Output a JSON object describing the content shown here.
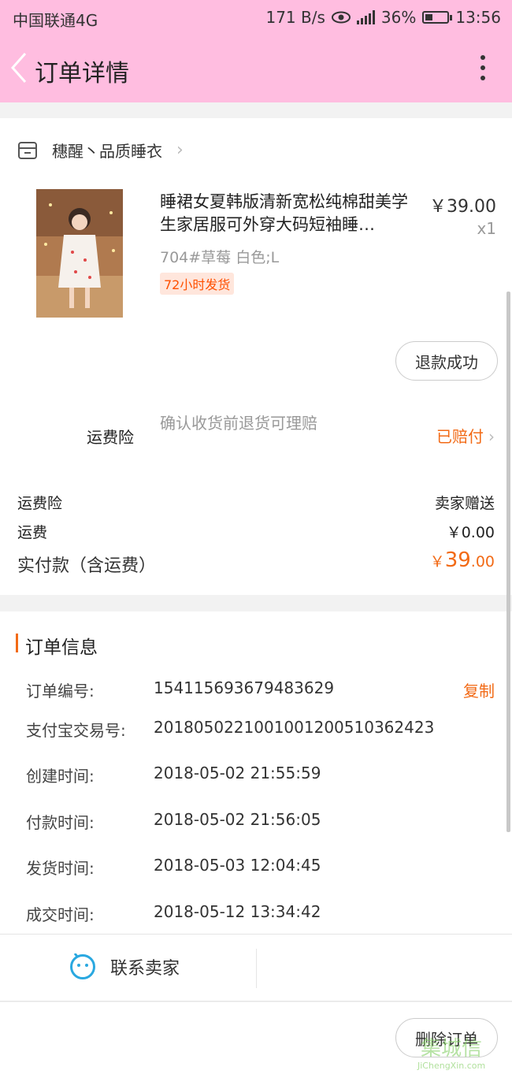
{
  "status_bar": {
    "carrier": "中国联通4G",
    "speed": "171 B/s",
    "battery": "36%",
    "battery_level": 0.36,
    "time": "13:56"
  },
  "nav": {
    "title": "订单详情"
  },
  "shop": {
    "name": "穗醒丶品质睡衣"
  },
  "product": {
    "title": "睡裙女夏韩版清新宽松纯棉甜美学生家居服可外穿大码短袖睡…",
    "price": "￥39.00",
    "qty": "x1",
    "sku": "704#草莓 白色;L",
    "tag": "72小时发货",
    "refund_button": "退款成功"
  },
  "insurance": {
    "label": "运费险",
    "desc": "确认收货前退货可理赔",
    "status": "已赔付"
  },
  "fees": {
    "insurance_label": "运费险",
    "insurance_value": "卖家赠送",
    "shipping_label": "运费",
    "shipping_value": "￥0.00",
    "paid_label": "实付款（含运费）",
    "paid_currency": "￥",
    "paid_int": "39",
    "paid_dec": ".00"
  },
  "order_info": {
    "title": "订单信息",
    "copy_label": "复制",
    "rows": [
      {
        "k": "订单编号:",
        "v": "154115693679483629"
      },
      {
        "k": "支付宝交易号:",
        "v": "2018050221001001200510362423"
      },
      {
        "k": "创建时间:",
        "v": "2018-05-02 21:55:59"
      },
      {
        "k": "付款时间:",
        "v": "2018-05-02 21:56:05"
      },
      {
        "k": "发货时间:",
        "v": "2018-05-03 12:04:45"
      },
      {
        "k": "成交时间:",
        "v": "2018-05-12 13:34:42"
      }
    ]
  },
  "actions": {
    "contact_seller": "联系卖家",
    "delete_order": "删除订单"
  },
  "watermark": {
    "main": "集城信",
    "sub": "JiChengXin.com"
  },
  "colors": {
    "header": "#ffbde0",
    "accent": "#f26a16",
    "contact_icon": "#2aa8e0"
  }
}
